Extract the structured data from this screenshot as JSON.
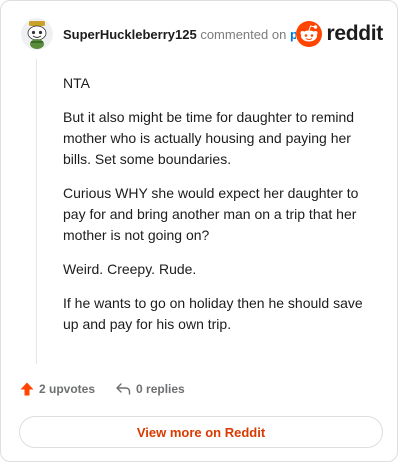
{
  "comment": {
    "username": "SuperHuckleberry125",
    "commented_text": "commented on",
    "post_link_text": "post",
    "brand_name": "reddit",
    "paragraphs": [
      "NTA",
      "But it also might be time for daughter to remind mother who is actually housing and paying her bills. Set some boundaries.",
      "Curious WHY she would expect her daughter to pay for and bring another man on a trip that her mother is not going on?",
      "Weird. Creepy. Rude.",
      "If he wants to go on holiday then he should save up and pay for his own trip."
    ],
    "upvotes_label": "2 upvotes",
    "replies_label": "0 replies",
    "view_more_label": "View more on Reddit"
  },
  "colors": {
    "brand_orange": "#ff4500",
    "link_blue": "#0079d3",
    "view_more_text": "#d93a00",
    "meta_gray": "#7c7c7c"
  },
  "icons": {
    "avatar": "snoo-avatar",
    "upvote": "upvote-arrow-icon",
    "reply": "reply-arrow-icon",
    "brand": "reddit-snoo-icon"
  }
}
